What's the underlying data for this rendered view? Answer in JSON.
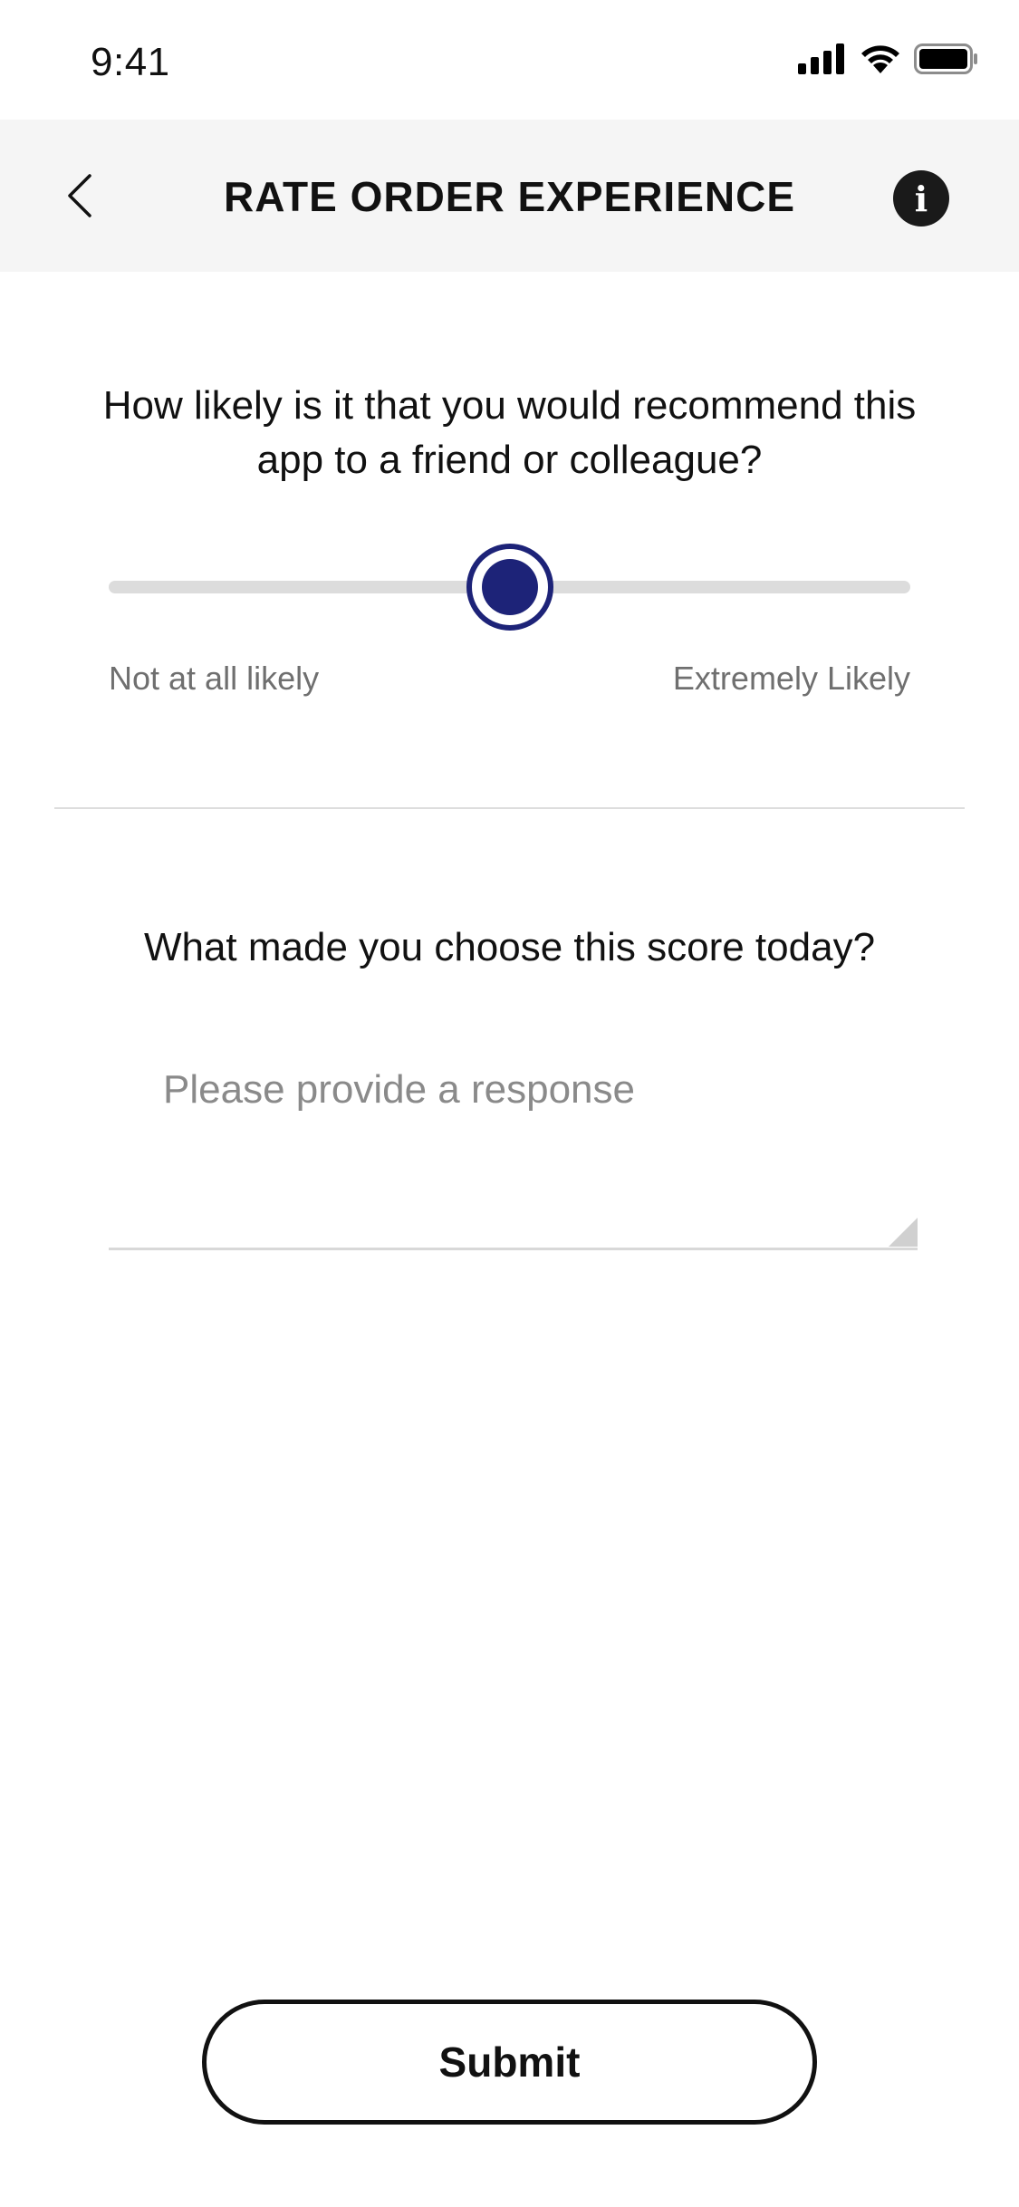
{
  "status_bar": {
    "time": "9:41",
    "icons": [
      "signal-icon",
      "wifi-icon",
      "battery-icon"
    ]
  },
  "header": {
    "title": "RATE ORDER EXPERIENCE",
    "back_icon": "chevron-left-icon",
    "info_icon": "info-icon",
    "info_glyph": "i",
    "background_color": "#f5f5f5"
  },
  "recommend": {
    "question": "How likely is it that you would recommend this app to a friend or colleague?",
    "slider": {
      "value_fraction": 0.5,
      "min_label": "Not at all likely",
      "max_label": "Extremely Likely",
      "accent_color": "#1d2378"
    }
  },
  "reason": {
    "question": "What made you choose this score today?",
    "placeholder": "Please provide a response",
    "value": ""
  },
  "submit": {
    "label": "Submit"
  }
}
